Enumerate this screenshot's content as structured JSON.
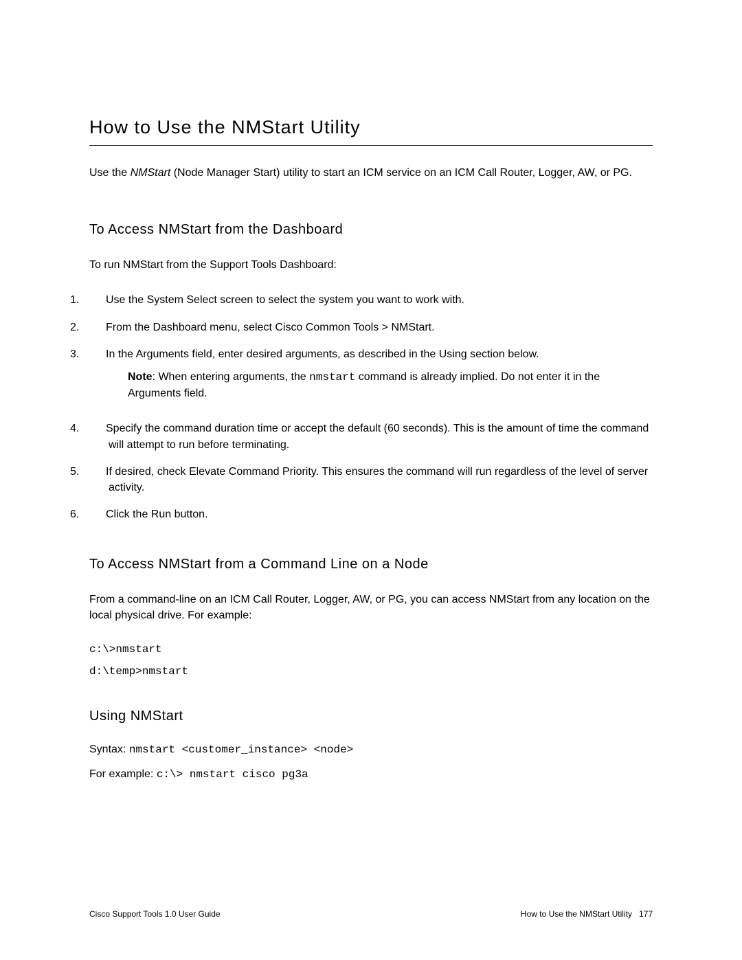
{
  "title": "How to Use the NMStart Utility",
  "intro_prefix": "Use the ",
  "intro_italic": "NMStart",
  "intro_suffix": " (Node Manager Start) utility to start an ICM service on an ICM Call Router, Logger, AW, or PG.",
  "section1": {
    "heading": "To Access NMStart from the Dashboard",
    "intro": "To run NMStart from the Support Tools Dashboard:",
    "steps": [
      {
        "num": "1.",
        "text": "Use the System Select screen to select the system you want to work with."
      },
      {
        "num": "2.",
        "text": "From the Dashboard menu, select Cisco Common Tools > NMStart."
      },
      {
        "num": "3.",
        "text": "In the Arguments field, enter desired arguments, as described in the Using section below."
      },
      {
        "num": "4.",
        "text": "Specify the command duration time or accept the default (60 seconds). This is the amount of time the command will attempt to run before terminating."
      },
      {
        "num": "5.",
        "text": "If desired, check Elevate Command Priority. This ensures the command will run regardless of the level of server activity."
      },
      {
        "num": "6.",
        "text": "Click the Run button."
      }
    ],
    "note_label": "Note",
    "note_prefix": ": When entering arguments, the ",
    "note_mono": "nmstart",
    "note_suffix": " command is already implied. Do not enter it in the Arguments field."
  },
  "section2": {
    "heading": "To Access NMStart from a Command Line on a Node",
    "intro": "From a command-line on an ICM Call Router, Logger, AW, or PG, you can access NMStart from any location on the local physical drive. For example:",
    "code1": "c:\\>nmstart",
    "code2": "d:\\temp>nmstart"
  },
  "section3": {
    "heading": "Using NMStart",
    "syntax_label": "Syntax: ",
    "syntax_code": "nmstart <customer_instance> <node>",
    "example_label": "For example: ",
    "example_code": "c:\\> nmstart cisco pg3a"
  },
  "footer": {
    "left": "Cisco Support Tools 1.0 User Guide",
    "right_text": "How to Use the NMStart Utility",
    "page_num": "177"
  }
}
